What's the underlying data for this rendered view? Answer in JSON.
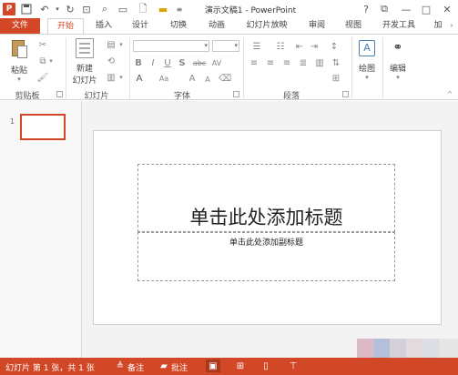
{
  "window": {
    "title": "演示文稿1 - PowerPoint",
    "app_logo": "P",
    "help": "?",
    "ribbon_display": "⧉",
    "minimize": "—",
    "maximize": "□",
    "close": "✕"
  },
  "tabs": [
    "文件",
    "开始",
    "插入",
    "设计",
    "切换",
    "动画",
    "幻灯片放映",
    "审阅",
    "视图",
    "开发工具",
    "加"
  ],
  "ribbon": {
    "clipboard": {
      "paste_label": "粘贴",
      "group_label": "剪贴板"
    },
    "slides": {
      "new_slide_label_1": "新建",
      "new_slide_label_2": "幻灯片",
      "group_label": "幻灯片"
    },
    "font": {
      "group_label": "字体",
      "buttons": [
        "B",
        "I",
        "U",
        "S",
        "abc",
        "AV",
        "Aa"
      ]
    },
    "paragraph": {
      "group_label": "段落"
    },
    "drawing": {
      "label": "绘图"
    },
    "editing": {
      "label": "编辑"
    }
  },
  "thumbnails": {
    "number": "1"
  },
  "slide": {
    "title_placeholder": "单击此处添加标题",
    "subtitle_placeholder": "单击此处添加副标题"
  },
  "statusbar": {
    "slide_info": "幻灯片 第 1 张，共 1 张",
    "notes_label": "备注",
    "comments_label": "批注"
  },
  "colors": {
    "accent": "#d24726",
    "slide_background": "#ffffff",
    "workspace_background": "#f3f3f3"
  }
}
